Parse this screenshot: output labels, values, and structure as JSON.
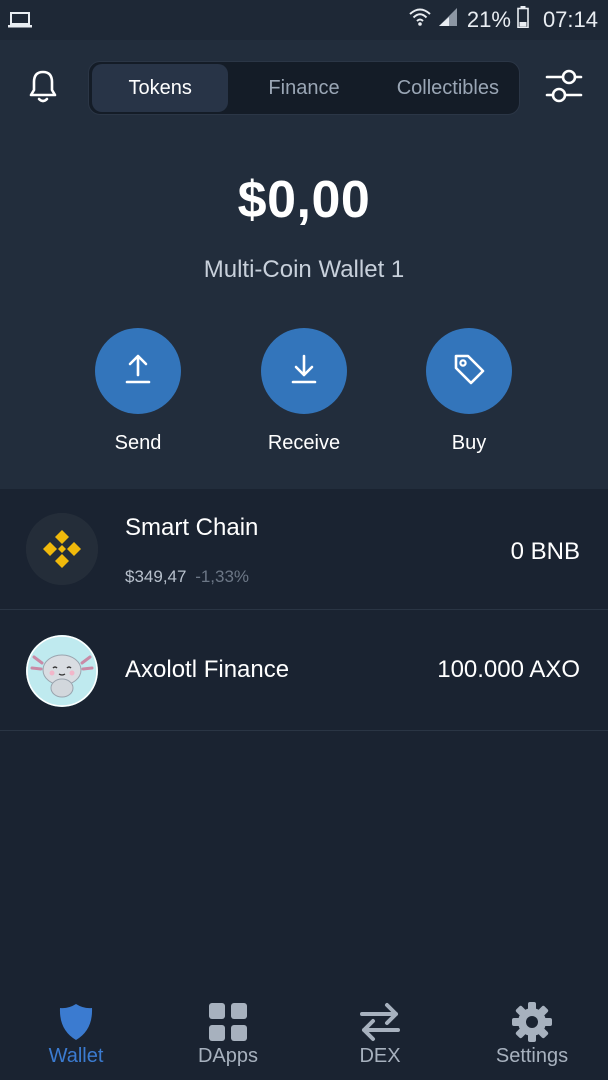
{
  "status_bar": {
    "battery": "21%",
    "time": "07:14"
  },
  "header": {
    "tabs": [
      {
        "label": "Tokens",
        "active": true
      },
      {
        "label": "Finance",
        "active": false
      },
      {
        "label": "Collectibles",
        "active": false
      }
    ],
    "bell_icon": "bell-icon",
    "filter_icon": "sliders-icon"
  },
  "wallet": {
    "balance": "$0,00",
    "name": "Multi-Coin Wallet 1"
  },
  "actions": [
    {
      "label": "Send",
      "icon": "arrow-up-icon"
    },
    {
      "label": "Receive",
      "icon": "arrow-down-icon"
    },
    {
      "label": "Buy",
      "icon": "tag-icon"
    }
  ],
  "tokens": [
    {
      "name": "Smart Chain",
      "price": "$349,47",
      "change": "-1,33%",
      "balance": "0 BNB",
      "icon": "bnb-icon"
    },
    {
      "name": "Axolotl Finance",
      "price": "",
      "change": "",
      "balance": "100.000 AXO",
      "icon": "axolotl-icon"
    }
  ],
  "bottom_nav": [
    {
      "label": "Wallet",
      "icon": "shield-icon",
      "active": true
    },
    {
      "label": "DApps",
      "icon": "grid-icon",
      "active": false
    },
    {
      "label": "DEX",
      "icon": "swap-icon",
      "active": false
    },
    {
      "label": "Settings",
      "icon": "gear-icon",
      "active": false
    }
  ],
  "colors": {
    "accent": "#3375bb",
    "active_nav": "#3b7bd0",
    "background": "#1a2331",
    "header_bg": "#222d3c",
    "bnb_yellow": "#f0b90b"
  }
}
